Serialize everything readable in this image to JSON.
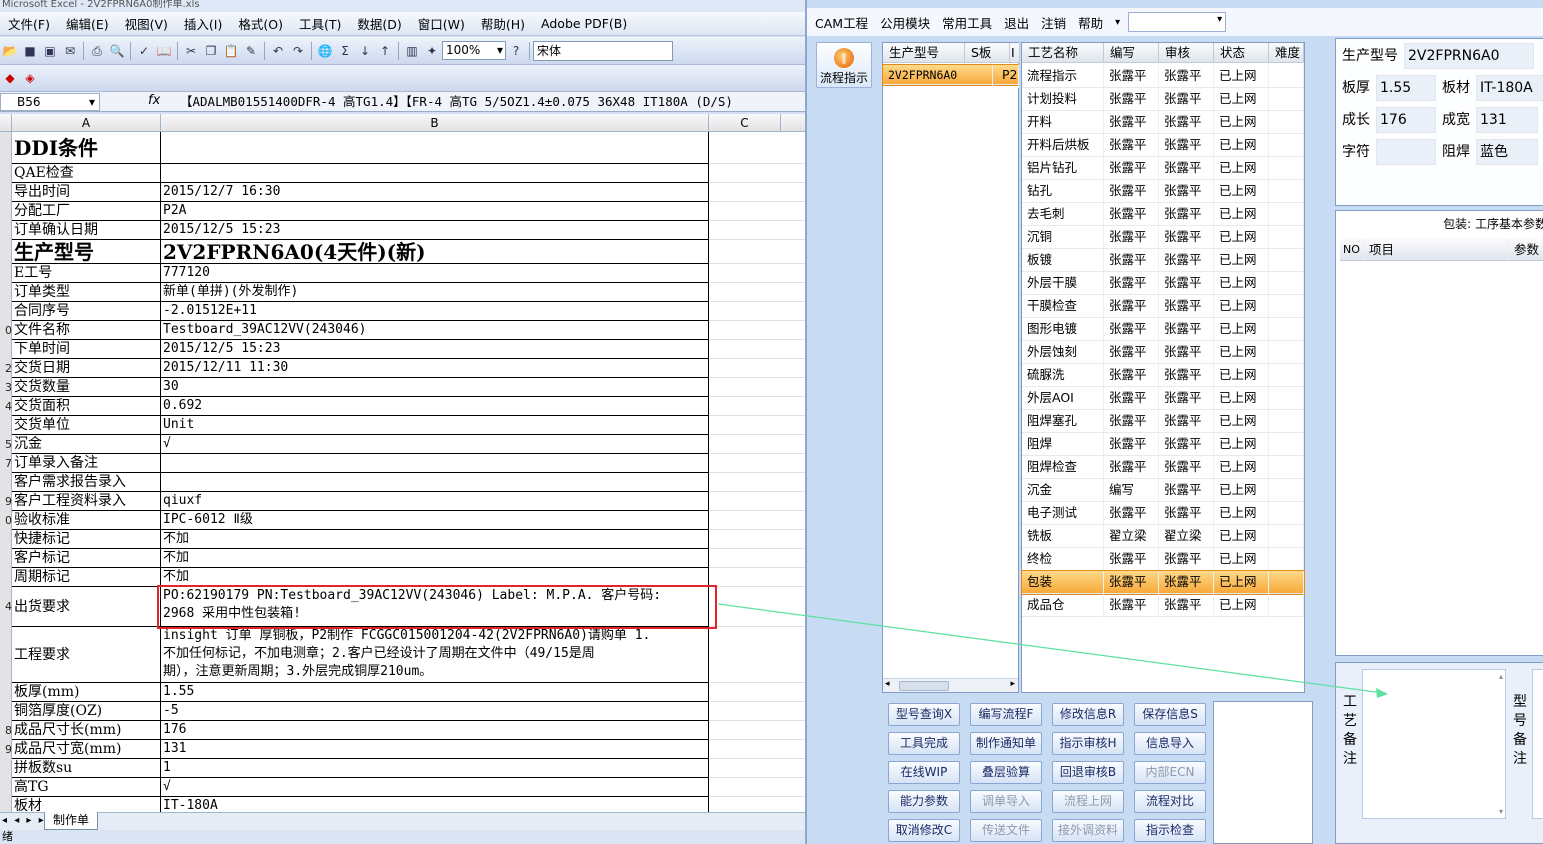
{
  "excel": {
    "title": "Microsoft Excel - 2V2FPRN6A0制作单.xls",
    "menu": [
      "文件(F)",
      "编辑(E)",
      "视图(V)",
      "插入(I)",
      "格式(O)",
      "工具(T)",
      "数据(D)",
      "窗口(W)",
      "帮助(H)",
      "Adobe PDF(B)"
    ],
    "zoom": "100%",
    "font": "宋体",
    "name_box": "B56",
    "fx_icon": "fx",
    "formula": "【ADALMB01551400DFR-4 高TG1.4】【FR-4 高TG 5/5OZ1.4±0.075 36X48  IT180A (D/S)",
    "columns": [
      "A",
      "B",
      "C"
    ],
    "rows": [
      {
        "rn": "",
        "a": "DDI条件",
        "b": "",
        "style": "big"
      },
      {
        "rn": "",
        "a": "QAE检查",
        "b": ""
      },
      {
        "rn": "",
        "a": "导出时间",
        "b": "2015/12/7 16:30"
      },
      {
        "rn": "",
        "a": "分配工厂",
        "b": "P2A"
      },
      {
        "rn": "",
        "a": "订单确认日期",
        "b": "2015/12/5 15:23"
      },
      {
        "rn": "",
        "a": "生产型号",
        "b": "2V2FPRN6A0(4天件)(新)",
        "style": "big"
      },
      {
        "rn": "",
        "a": "E工号",
        "b": "777120"
      },
      {
        "rn": "",
        "a": "订单类型",
        "b": "新单(单拼)(外发制作)"
      },
      {
        "rn": "",
        "a": "合同序号",
        "b": "-2.01512E+11"
      },
      {
        "rn": "0",
        "a": "文件名称",
        "b": "Testboard_39AC12VV(243046)"
      },
      {
        "rn": "",
        "a": "下单时间",
        "b": "2015/12/5 15:23"
      },
      {
        "rn": "2",
        "a": "交货日期",
        "b": "2015/12/11 11:30"
      },
      {
        "rn": "3",
        "a": "交货数量",
        "b": "30"
      },
      {
        "rn": "4",
        "a": "交货面积",
        "b": "0.692"
      },
      {
        "rn": "",
        "a": "交货单位",
        "b": "Unit"
      },
      {
        "rn": "5",
        "a": "沉金",
        "b": "√"
      },
      {
        "rn": "7",
        "a": "订单录入备注",
        "b": ""
      },
      {
        "rn": "",
        "a": "客户需求报告录入",
        "b": ""
      },
      {
        "rn": "9",
        "a": "客户工程资料录入",
        "b": "qiuxf"
      },
      {
        "rn": "0",
        "a": "验收标准",
        "b": "IPC-6012 Ⅱ级"
      },
      {
        "rn": "",
        "a": "快捷标记",
        "b": "不加"
      },
      {
        "rn": "",
        "a": "客户标记",
        "b": "不加"
      },
      {
        "rn": "",
        "a": "周期标记",
        "b": "不加"
      },
      {
        "rn": "4",
        "a": "出货要求",
        "b": "PO:62190179 PN:Testboard_39AC12VV(243046) Label: M.P.A. 客户号码:",
        "b2": "2968 采用中性包装箱!",
        "style": "tall"
      },
      {
        "rn": "",
        "a": "工程要求",
        "b": "insight 订单  厚铜板，P2制作  FCGGC015001204-42(2V2FPRN6A0)请购单 1.",
        "b2": "不加任何标记，不加电测章；2.客户已经设计了周期在文件中（49/15是周",
        "b3": "期），注意更新周期；3.外层完成铜厚210um。",
        "style": "taller"
      },
      {
        "rn": "",
        "a": "板厚(mm)",
        "b": "1.55"
      },
      {
        "rn": "",
        "a": "铜箔厚度(OZ)",
        "b": "-5"
      },
      {
        "rn": "8",
        "a": "成品尺寸长(mm)",
        "b": "176"
      },
      {
        "rn": "9",
        "a": "成品尺寸宽(mm)",
        "b": "131"
      },
      {
        "rn": "",
        "a": "拼板数su",
        "b": "1"
      },
      {
        "rn": "",
        "a": "高TG",
        "b": "√"
      },
      {
        "rn": "",
        "a": "板材",
        "b": "IT-180A"
      }
    ],
    "sheet_nav": "◂ ◂ ▸ ▸|",
    "sheet_tab": "制作单",
    "status": "绪"
  },
  "cam": {
    "menu": [
      "CAM工程",
      "公用模块",
      "常用工具",
      "退出",
      "注销",
      "帮助"
    ],
    "help_arrow": "▾",
    "combo_value": "",
    "flow_button": "流程指示",
    "flow_icon_glyph": "‖",
    "model_headers": [
      "生产型号",
      "S板",
      "I"
    ],
    "model_rows": [
      {
        "model": "2V2FPRN6A0",
        "plant": "P2"
      }
    ],
    "proc_headers": [
      "工艺名称",
      "编写",
      "审核",
      "状态",
      "难度"
    ],
    "proc_rows": [
      [
        "流程指示",
        "张露平",
        "张露平",
        "已上网"
      ],
      [
        "计划投料",
        "张露平",
        "张露平",
        "已上网"
      ],
      [
        "开料",
        "张露平",
        "张露平",
        "已上网"
      ],
      [
        "开料后烘板",
        "张露平",
        "张露平",
        "已上网"
      ],
      [
        "铝片钻孔",
        "张露平",
        "张露平",
        "已上网"
      ],
      [
        "钻孔",
        "张露平",
        "张露平",
        "已上网"
      ],
      [
        "去毛刺",
        "张露平",
        "张露平",
        "已上网"
      ],
      [
        "沉铜",
        "张露平",
        "张露平",
        "已上网"
      ],
      [
        "板镀",
        "张露平",
        "张露平",
        "已上网"
      ],
      [
        "外层干膜",
        "张露平",
        "张露平",
        "已上网"
      ],
      [
        "干膜检查",
        "张露平",
        "张露平",
        "已上网"
      ],
      [
        "图形电镀",
        "张露平",
        "张露平",
        "已上网"
      ],
      [
        "外层蚀刻",
        "张露平",
        "张露平",
        "已上网"
      ],
      [
        "硫脲洗",
        "张露平",
        "张露平",
        "已上网"
      ],
      [
        "外层AOI",
        "张露平",
        "张露平",
        "已上网"
      ],
      [
        "阻焊塞孔",
        "张露平",
        "张露平",
        "已上网"
      ],
      [
        "阻焊",
        "张露平",
        "张露平",
        "已上网"
      ],
      [
        "阻焊检查",
        "张露平",
        "张露平",
        "已上网"
      ],
      [
        "沉金",
        "编写",
        "张露平",
        "已上网"
      ],
      [
        "电子测试",
        "张露平",
        "张露平",
        "已上网"
      ],
      [
        "铣板",
        "翟立梁",
        "翟立梁",
        "已上网"
      ],
      [
        "终检",
        "张露平",
        "张露平",
        "已上网"
      ],
      [
        "包装",
        "张露平",
        "张露平",
        "已上网"
      ],
      [
        "成品仓",
        "张露平",
        "张露平",
        "已上网"
      ]
    ],
    "selected_proc": 22,
    "buttons": [
      [
        "型号查询X",
        "编写流程F",
        "修改信息R",
        "保存信息S"
      ],
      [
        "工具完成",
        "制作通知单",
        "指示审核H",
        "信息导入"
      ],
      [
        "在线WIP",
        "叠层验算",
        "回退审核B",
        "内部ECN"
      ],
      [
        "能力参数",
        "调单导入",
        "流程上网",
        "流程对比"
      ],
      [
        "取消修改C",
        "传送文件",
        "接外调资料",
        "指示检查"
      ]
    ],
    "disabled_buttons": [
      "内部ECN",
      "调单导入",
      "流程上网",
      "传送文件",
      "接外调资料"
    ],
    "info": {
      "model_label": "生产型号",
      "model": "2V2FPRN6A0",
      "thick_label": "板厚",
      "thick": "1.55",
      "mat_label": "板材",
      "mat": "IT-180A",
      "len_label": "成长",
      "len": "176",
      "wid_label": "成宽",
      "wid": "131",
      "char_label": "字符",
      "char": "",
      "mask_label": "阻焊",
      "mask": "蓝色"
    },
    "pack_title": "包装: 工序基本参数",
    "pack_headers": [
      "NO",
      "项目",
      "参数"
    ],
    "remark_left": [
      "工",
      "艺",
      "备",
      "注"
    ],
    "remark_right": [
      "型",
      "号",
      "备",
      "注"
    ],
    "accent": "#f7a93a",
    "arrow_color": "#5ee0a0",
    "highlight_color": "#e0262b"
  }
}
